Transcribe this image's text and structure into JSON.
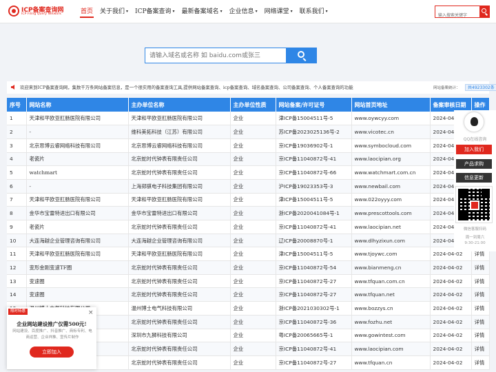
{
  "header": {
    "logo_title": "ICP备案查询网",
    "logo_subtitle": "ICP Filing Query Network",
    "nav": [
      {
        "label": "首页",
        "dropdown": false,
        "active": true
      },
      {
        "label": "关于我们",
        "dropdown": true
      },
      {
        "label": "ICP备案查询",
        "dropdown": true
      },
      {
        "label": "最新备案域名",
        "dropdown": true
      },
      {
        "label": "企业信息",
        "dropdown": true
      },
      {
        "label": "网络课堂",
        "dropdown": true
      },
      {
        "label": "联系我们",
        "dropdown": true
      }
    ],
    "search_placeholder": "输入搜索关键字"
  },
  "hero": {
    "search_placeholder": "请输入域名或名称 如 baidu.com或张三"
  },
  "notice": {
    "text": "欢迎来到ICP备案查询网，集数千万条网站备案信息，是一个很实用的备案查询工具,提供网站备案查询、icp备案查询、域名备案查询、公司备案查询、个人备案查询的功能",
    "stat_label": "网站备案统计：",
    "stat_value": "共4923302条"
  },
  "table": {
    "headers": [
      "序号",
      "网站名称",
      "主办单位名称",
      "主办单位性质",
      "网站备案/许可证号",
      "网站首页地址",
      "备案审核日期",
      "操作"
    ],
    "rows": [
      [
        "1",
        "天津和平欧亚肛肠医院有限公司",
        "天津和平欧亚肛肠医院有限公司",
        "企业",
        "津ICP备15004511号-5",
        "www.oywcyy.com",
        "2024-04-02",
        "详情"
      ],
      [
        "2",
        "-",
        "维科美拓科技（江苏）有限公司",
        "企业",
        "苏ICP备2023025136号-2",
        "www.vicotec.cn",
        "2024-04-02",
        "详情"
      ],
      [
        "3",
        "北京思博云睿网络科技有限公司",
        "北京思博云睿网络科技有限公司",
        "企业",
        "京ICP备19036902号-1",
        "www.symbocloud.com",
        "2024-04-02",
        "详情"
      ],
      [
        "4",
        "老瓷片",
        "北京蛇时代钟表有限责任公司",
        "企业",
        "京ICP备11040872号-41",
        "www.laocipian.org",
        "2024-04-02",
        "详情"
      ],
      [
        "5",
        "watchmart",
        "北京蛇时代钟表有限责任公司",
        "企业",
        "京ICP备11040872号-66",
        "www.watchmart.com.cn",
        "2024-04-02",
        "详情"
      ],
      [
        "6",
        "-",
        "上海郑骐电子科技集团有限公司",
        "企业",
        "沪ICP备19023353号-3",
        "www.newbail.com",
        "2024-04-02",
        "详情"
      ],
      [
        "7",
        "天津和平欧亚肛肠医院有限公司",
        "天津和平欧亚肛肠医院有限公司",
        "企业",
        "津ICP备15004511号-5",
        "www.022oyyy.com",
        "2024-04-02",
        "详情"
      ],
      [
        "8",
        "金华市宝雷特进出口有限公司",
        "金华市宝雷特进出口有限公司",
        "企业",
        "浙ICP备2020041084号-1",
        "www.prescottools.com",
        "2024-04-02",
        "详情"
      ],
      [
        "9",
        "老瓷片",
        "北京蛇时代钟表有限责任公司",
        "企业",
        "京ICP备11040872号-41",
        "www.laocipian.net",
        "2024-04-02",
        "详情"
      ],
      [
        "10",
        "大连海越企业管理咨询有限公司",
        "大连海越企业管理咨询有限公司",
        "企业",
        "辽ICP备20008870号-1",
        "www.dlhyzixun.com",
        "2024-04-02",
        "详情"
      ],
      [
        "11",
        "天津和平欧亚肛肠医院有限公司",
        "天津和平欧亚肛肠医院有限公司",
        "企业",
        "津ICP备15004511号-5",
        "www.tjoywc.com",
        "2024-04-02",
        "详情"
      ],
      [
        "12",
        "变形金刚变速TF圈",
        "北京蛇时代钟表有限责任公司",
        "企业",
        "京ICP备11040872号-54",
        "www.bianmeng.cn",
        "2024-04-02",
        "详情"
      ],
      [
        "13",
        "变速圈",
        "北京蛇时代钟表有限责任公司",
        "企业",
        "京ICP备11040872号-27",
        "www.tfquan.com.cn",
        "2024-04-02",
        "详情"
      ],
      [
        "14",
        "变速圈",
        "北京蛇时代钟表有限责任公司",
        "企业",
        "京ICP备11040872号-27",
        "www.tfquan.net",
        "2024-04-02",
        "详情"
      ],
      [
        "15",
        "温州博士电气科技有限公司",
        "温州博士电气科技有限公司",
        "企业",
        "浙ICP备2021030302号-1",
        "www.bozzys.cn",
        "2024-04-02",
        "详情"
      ],
      [
        "16",
        "北京蛇时代钟表有限责任公司",
        "北京蛇时代钟表有限责任公司",
        "企业",
        "京ICP备11040872号-36",
        "www.fozhu.net",
        "2024-04-02",
        "详情"
      ],
      [
        "17",
        "深圳市九狮科技有限公司",
        "深圳市九狮科技有限公司",
        "企业",
        "粤ICP备20065665号-1",
        "www.gowintest.com",
        "2024-04-02",
        "详情"
      ],
      [
        "18",
        "老瓷片",
        "北京蛇时代钟表有限责任公司",
        "企业",
        "京ICP备11040872号-41",
        "www.laocipian.com",
        "2024-04-02",
        "详情"
      ],
      [
        "19",
        "变速圈",
        "北京蛇时代钟表有限责任公司",
        "企业",
        "京ICP备11040872号-27",
        "www.tfquan.cn",
        "2024-04-02",
        "详情"
      ]
    ]
  },
  "right_float": {
    "qq_label": "QQ在线咨询",
    "join_label": "加入我们",
    "purchase_label": "产品求购",
    "info_label": "信息更新",
    "qr_caption": "微信客服扫码",
    "hours_days": "周一到周六",
    "hours_time": "9:30-21:00"
  },
  "popup": {
    "tag": "限时特惠",
    "close": "×",
    "title": "企业网站建设推广仅需500元!",
    "desc": "网站建设、百度推广、抖音推广、商标专利、电商运营、企业祥推、宣传片制作",
    "button": "立即加入"
  },
  "colors": {
    "brand_red": "#e0281e",
    "primary_blue": "#2f86e6",
    "background": "#f1f3f7"
  }
}
